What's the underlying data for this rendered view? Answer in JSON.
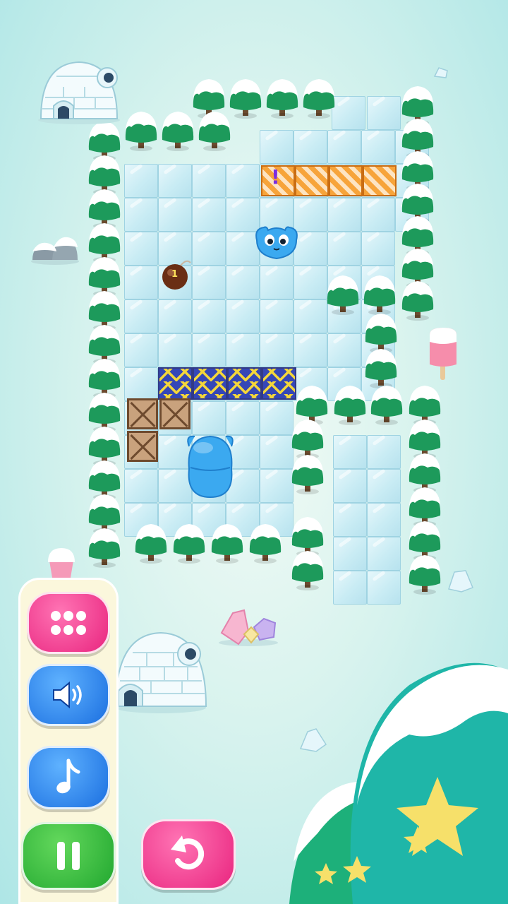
{
  "colors": {
    "ice": "#c9ecf4",
    "tree_green": "#1d9a5b",
    "snow": "#ffffff",
    "jelly_blue": "#3ba9f0",
    "hazard_orange": "#f7a43a",
    "arrow_blue": "#3547b7",
    "arrow_yellow": "#f4d63a",
    "button_pink": "#f0368f",
    "button_blue": "#1e7ee8",
    "button_green": "#31b83b"
  },
  "board": {
    "bomb_counter": "1",
    "switch_symbol": "!"
  },
  "controls": {
    "menu": {
      "icon": "grid-dots-icon"
    },
    "sound": {
      "icon": "speaker-icon"
    },
    "music": {
      "icon": "music-note-icon"
    },
    "pause": {
      "icon": "pause-icon"
    },
    "restart": {
      "icon": "restart-arrow-icon"
    }
  }
}
